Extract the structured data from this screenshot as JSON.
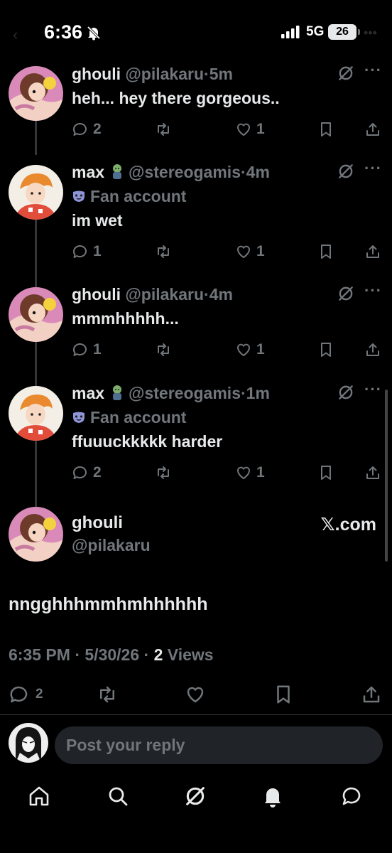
{
  "status_bar": {
    "time": "6:36",
    "network": "5G",
    "battery": "26"
  },
  "replies": [
    {
      "name": "ghouli",
      "handle": "@pilakaru",
      "time": "5m",
      "badge": "",
      "text": "heh... hey there gorgeous..",
      "replies": "2",
      "reposts": "",
      "likes": "1"
    },
    {
      "name": "max",
      "handle": "@stereogamis",
      "time": "4m",
      "badge": "Fan account",
      "text": "im wet",
      "replies": "1",
      "reposts": "",
      "likes": "1"
    },
    {
      "name": "ghouli",
      "handle": "@pilakaru",
      "time": "4m",
      "badge": "",
      "text": "mmmhhhhh...",
      "replies": "1",
      "reposts": "",
      "likes": "1"
    },
    {
      "name": "max",
      "handle": "@stereogamis",
      "time": "1m",
      "badge": "Fan account",
      "text": "ffuuuckkkkk harder",
      "replies": "2",
      "reposts": "",
      "likes": "1"
    }
  ],
  "main_post": {
    "name": "ghouli",
    "handle": "@pilakaru",
    "watermark": "𝕏.com",
    "text": "nngghhhmmhmhhhhhh",
    "time": "6:35 PM",
    "date": "5/30/26",
    "views_count": "2",
    "views_label": "Views",
    "replies": "2"
  },
  "reply_box": {
    "placeholder": "Post your reply"
  },
  "tab_bar": {
    "items": [
      "home-icon",
      "search-icon",
      "grok-icon",
      "notifications-icon",
      "messages-icon"
    ]
  },
  "colors": {
    "background": "#000000",
    "text": "#e7e9ea",
    "muted": "#71767b",
    "input_bg": "#202327"
  }
}
